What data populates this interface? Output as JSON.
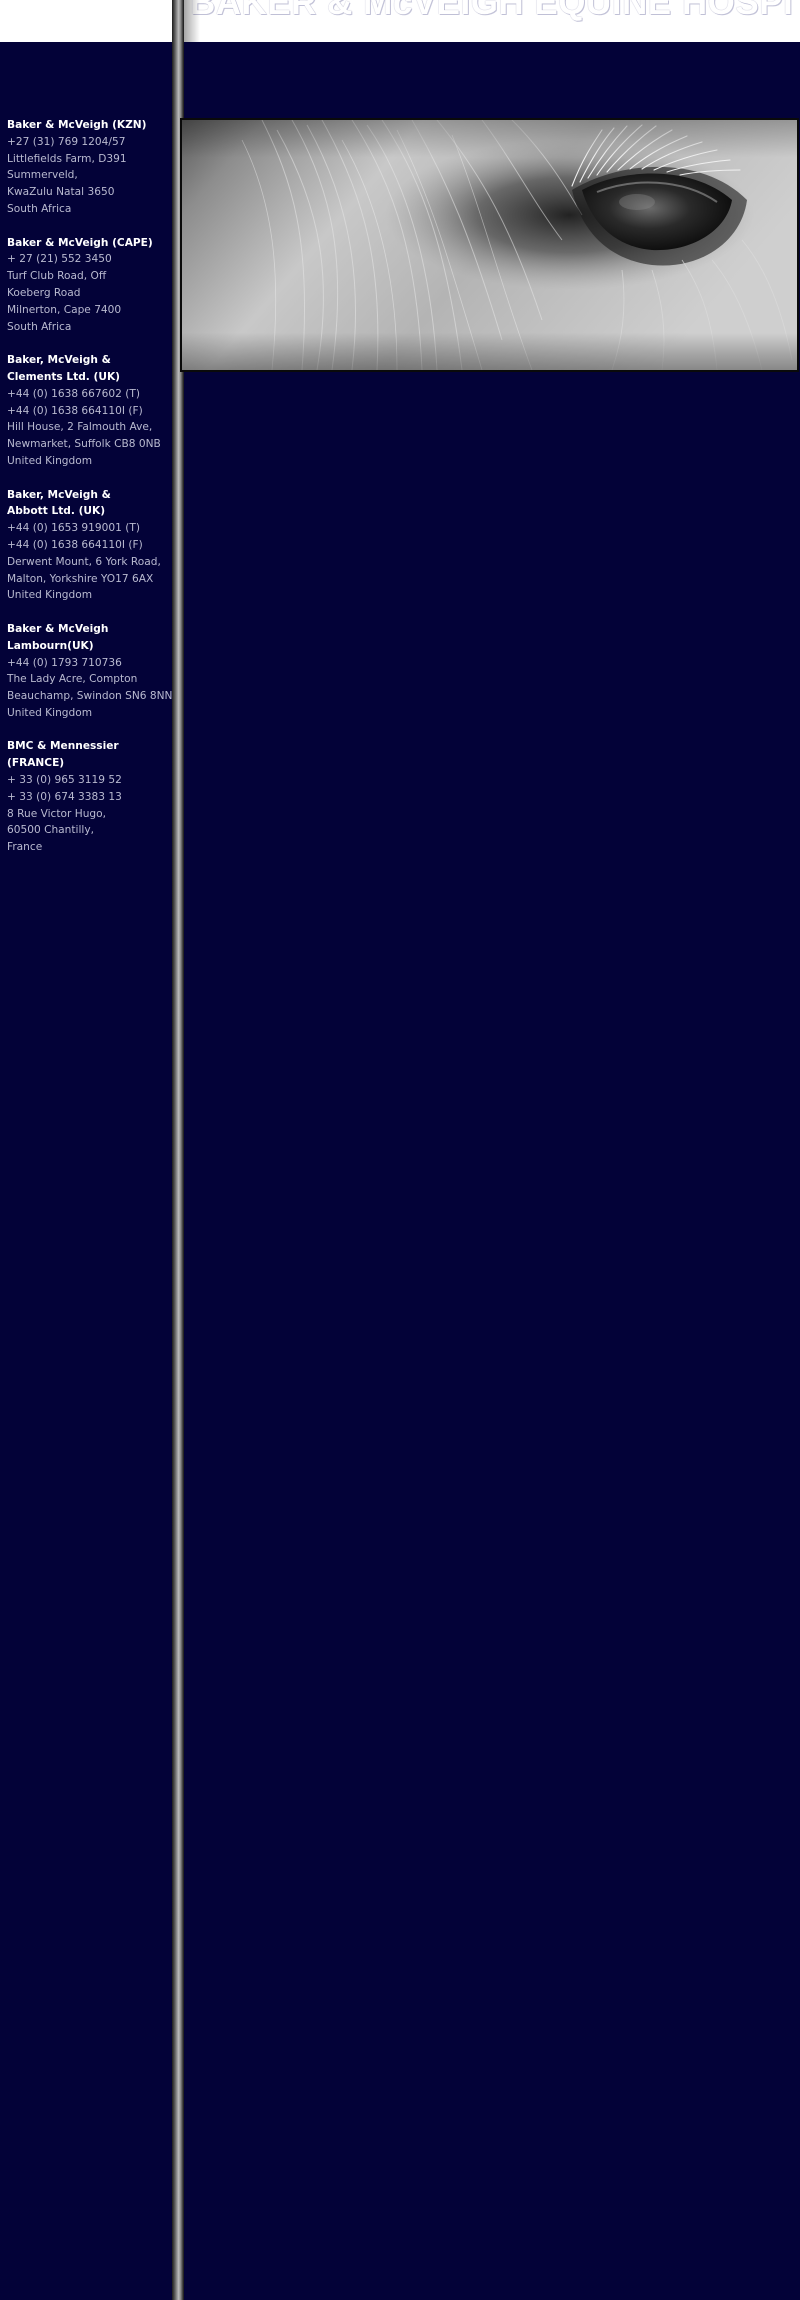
{
  "site": {
    "title": "BAKER & McVEIGH EQUINE HOSPITAL"
  },
  "contacts": [
    {
      "name": "Baker & McVeigh (KZN)",
      "lines": [
        "+27 (31) 769 1204/57",
        "Littlefields Farm, D391",
        "Summerveld,",
        "KwaZulu Natal 3650",
        "South Africa"
      ]
    },
    {
      "name": "Baker & McVeigh (CAPE)",
      "lines": [
        "+ 27 (21) 552 3450",
        "Turf Club Road, Off",
        "Koeberg Road",
        "Milnerton, Cape 7400",
        "South Africa"
      ]
    },
    {
      "name": "Baker, McVeigh & Clements Ltd. (UK)",
      "name_lines": [
        "Baker, McVeigh &",
        "Clements Ltd. (UK)"
      ],
      "lines": [
        "+44 (0) 1638 667602 (T)",
        "+44 (0) 1638 664110I (F)",
        "Hill House, 2 Falmouth Ave,",
        "Newmarket, Suffolk CB8 0NB",
        "United Kingdom"
      ]
    },
    {
      "name": "Baker, McVeigh & Abbott Ltd. (UK)",
      "name_lines": [
        "Baker, McVeigh &",
        "Abbott Ltd. (UK)"
      ],
      "lines": [
        "+44 (0) 1653 919001 (T)",
        "+44 (0) 1638 664110I (F)",
        "Derwent Mount, 6 York Road,",
        "Malton, Yorkshire  YO17 6AX",
        "United Kingdom"
      ]
    },
    {
      "name": "Baker & McVeigh Lambourn(UK)",
      "name_lines": [
        "Baker & McVeigh",
        "Lambourn(UK)"
      ],
      "lines": [
        "+44 (0) 1793 710736",
        "The Lady Acre, Compton",
        "Beauchamp, Swindon SN6 8NN",
        "United Kingdom"
      ]
    },
    {
      "name": "BMC & Mennessier (FRANCE)",
      "lines": [
        "+ 33 (0) 965 3119 52",
        "+ 33 (0) 674 3383 13",
        "8 Rue Victor Hugo,",
        "60500 Chantilly,",
        "France"
      ]
    }
  ],
  "hero": {
    "subject": "horse-eye-photo"
  },
  "colors": {
    "background": "#030238",
    "header": "#ffffff",
    "contact_name": "#ffffff",
    "contact_text": "#b9bad0"
  }
}
